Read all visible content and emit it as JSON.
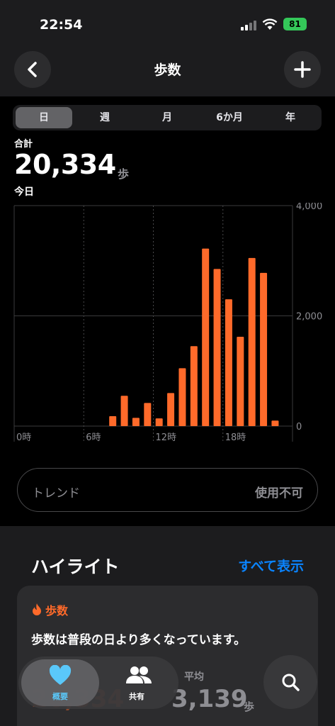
{
  "status_bar": {
    "time": "22:54",
    "battery": "81"
  },
  "nav": {
    "title": "歩数"
  },
  "segments": {
    "items": [
      "日",
      "週",
      "月",
      "6か月",
      "年"
    ],
    "active": "日"
  },
  "summary": {
    "label": "合計",
    "value": "20,334",
    "unit": "歩",
    "date": "今日"
  },
  "chart_data": {
    "type": "bar",
    "x_unit": "時",
    "x": [
      0,
      1,
      2,
      3,
      4,
      5,
      6,
      7,
      8,
      9,
      10,
      11,
      12,
      13,
      14,
      15,
      16,
      17,
      18,
      19,
      20,
      21,
      22,
      23
    ],
    "values": [
      0,
      0,
      0,
      0,
      0,
      0,
      0,
      0,
      180,
      550,
      150,
      420,
      140,
      600,
      1050,
      1450,
      3220,
      2850,
      2300,
      1620,
      3050,
      2780,
      100,
      0
    ],
    "x_tick_labels": [
      "0時",
      "6時",
      "12時",
      "18時"
    ],
    "y_tick_labels": [
      "4,000",
      "2,000",
      "0"
    ],
    "ylim": [
      0,
      4000
    ],
    "color": "#ff6a2a"
  },
  "trend": {
    "label": "トレンド",
    "value": "使用不可"
  },
  "highlights": {
    "title": "ハイライト",
    "link": "すべて表示",
    "card": {
      "category": "歩数",
      "text": "歩数は普段の日より多くなっています。",
      "today_value": "20,334",
      "avg_label": "平均",
      "avg_value": "3,139",
      "avg_unit": "歩"
    }
  },
  "tabbar": {
    "summary_label": "概要",
    "sharing_label": "共有"
  },
  "colors": {
    "accent": "#ff6a2a",
    "link": "#0a84ff",
    "heart": "#5ac8fa"
  }
}
